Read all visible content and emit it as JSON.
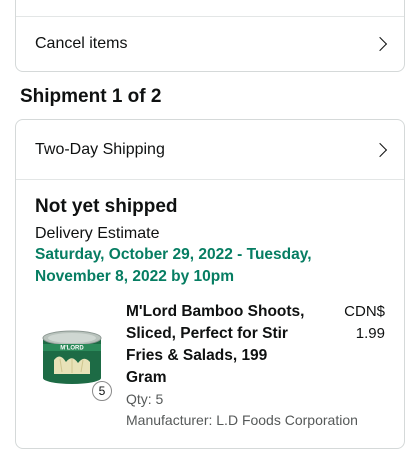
{
  "actions": {
    "cancel_label": "Cancel items"
  },
  "shipment": {
    "heading": "Shipment 1 of 2",
    "method_label": "Two-Day Shipping",
    "status": "Not yet shipped",
    "estimate_label": "Delivery Estimate",
    "estimate_dates": "Saturday, October 29, 2022 - Tuesday, November 8, 2022 by 10pm",
    "item": {
      "title": "M'Lord Bamboo Shoots, Sliced, Perfect for Stir Fries & Salads, 199 Gram",
      "price": "CDN$ 1.99",
      "qty_badge": "5",
      "qty": "Qty: 5",
      "manufacturer": "Manufacturer: L.D Foods Corporation",
      "image_brand": "M'LORD",
      "image_icon": "can-product-image"
    }
  },
  "colors": {
    "estimate_green": "#067d62",
    "border": "#d5d9d9"
  }
}
